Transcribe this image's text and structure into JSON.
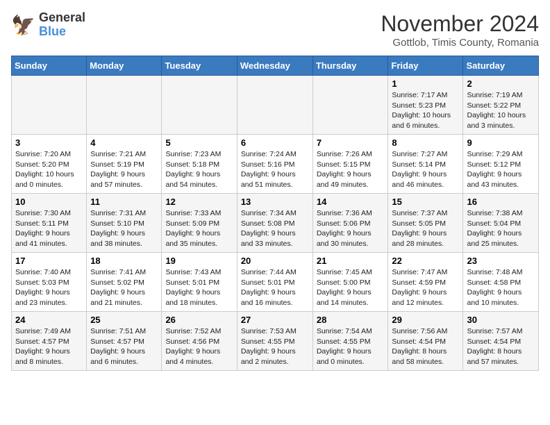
{
  "header": {
    "logo_general": "General",
    "logo_blue": "Blue",
    "month_title": "November 2024",
    "location": "Gottlob, Timis County, Romania"
  },
  "days_of_week": [
    "Sunday",
    "Monday",
    "Tuesday",
    "Wednesday",
    "Thursday",
    "Friday",
    "Saturday"
  ],
  "weeks": [
    [
      {
        "day": "",
        "info": ""
      },
      {
        "day": "",
        "info": ""
      },
      {
        "day": "",
        "info": ""
      },
      {
        "day": "",
        "info": ""
      },
      {
        "day": "",
        "info": ""
      },
      {
        "day": "1",
        "info": "Sunrise: 7:17 AM\nSunset: 5:23 PM\nDaylight: 10 hours and 6 minutes."
      },
      {
        "day": "2",
        "info": "Sunrise: 7:19 AM\nSunset: 5:22 PM\nDaylight: 10 hours and 3 minutes."
      }
    ],
    [
      {
        "day": "3",
        "info": "Sunrise: 7:20 AM\nSunset: 5:20 PM\nDaylight: 10 hours and 0 minutes."
      },
      {
        "day": "4",
        "info": "Sunrise: 7:21 AM\nSunset: 5:19 PM\nDaylight: 9 hours and 57 minutes."
      },
      {
        "day": "5",
        "info": "Sunrise: 7:23 AM\nSunset: 5:18 PM\nDaylight: 9 hours and 54 minutes."
      },
      {
        "day": "6",
        "info": "Sunrise: 7:24 AM\nSunset: 5:16 PM\nDaylight: 9 hours and 51 minutes."
      },
      {
        "day": "7",
        "info": "Sunrise: 7:26 AM\nSunset: 5:15 PM\nDaylight: 9 hours and 49 minutes."
      },
      {
        "day": "8",
        "info": "Sunrise: 7:27 AM\nSunset: 5:14 PM\nDaylight: 9 hours and 46 minutes."
      },
      {
        "day": "9",
        "info": "Sunrise: 7:29 AM\nSunset: 5:12 PM\nDaylight: 9 hours and 43 minutes."
      }
    ],
    [
      {
        "day": "10",
        "info": "Sunrise: 7:30 AM\nSunset: 5:11 PM\nDaylight: 9 hours and 41 minutes."
      },
      {
        "day": "11",
        "info": "Sunrise: 7:31 AM\nSunset: 5:10 PM\nDaylight: 9 hours and 38 minutes."
      },
      {
        "day": "12",
        "info": "Sunrise: 7:33 AM\nSunset: 5:09 PM\nDaylight: 9 hours and 35 minutes."
      },
      {
        "day": "13",
        "info": "Sunrise: 7:34 AM\nSunset: 5:08 PM\nDaylight: 9 hours and 33 minutes."
      },
      {
        "day": "14",
        "info": "Sunrise: 7:36 AM\nSunset: 5:06 PM\nDaylight: 9 hours and 30 minutes."
      },
      {
        "day": "15",
        "info": "Sunrise: 7:37 AM\nSunset: 5:05 PM\nDaylight: 9 hours and 28 minutes."
      },
      {
        "day": "16",
        "info": "Sunrise: 7:38 AM\nSunset: 5:04 PM\nDaylight: 9 hours and 25 minutes."
      }
    ],
    [
      {
        "day": "17",
        "info": "Sunrise: 7:40 AM\nSunset: 5:03 PM\nDaylight: 9 hours and 23 minutes."
      },
      {
        "day": "18",
        "info": "Sunrise: 7:41 AM\nSunset: 5:02 PM\nDaylight: 9 hours and 21 minutes."
      },
      {
        "day": "19",
        "info": "Sunrise: 7:43 AM\nSunset: 5:01 PM\nDaylight: 9 hours and 18 minutes."
      },
      {
        "day": "20",
        "info": "Sunrise: 7:44 AM\nSunset: 5:01 PM\nDaylight: 9 hours and 16 minutes."
      },
      {
        "day": "21",
        "info": "Sunrise: 7:45 AM\nSunset: 5:00 PM\nDaylight: 9 hours and 14 minutes."
      },
      {
        "day": "22",
        "info": "Sunrise: 7:47 AM\nSunset: 4:59 PM\nDaylight: 9 hours and 12 minutes."
      },
      {
        "day": "23",
        "info": "Sunrise: 7:48 AM\nSunset: 4:58 PM\nDaylight: 9 hours and 10 minutes."
      }
    ],
    [
      {
        "day": "24",
        "info": "Sunrise: 7:49 AM\nSunset: 4:57 PM\nDaylight: 9 hours and 8 minutes."
      },
      {
        "day": "25",
        "info": "Sunrise: 7:51 AM\nSunset: 4:57 PM\nDaylight: 9 hours and 6 minutes."
      },
      {
        "day": "26",
        "info": "Sunrise: 7:52 AM\nSunset: 4:56 PM\nDaylight: 9 hours and 4 minutes."
      },
      {
        "day": "27",
        "info": "Sunrise: 7:53 AM\nSunset: 4:55 PM\nDaylight: 9 hours and 2 minutes."
      },
      {
        "day": "28",
        "info": "Sunrise: 7:54 AM\nSunset: 4:55 PM\nDaylight: 9 hours and 0 minutes."
      },
      {
        "day": "29",
        "info": "Sunrise: 7:56 AM\nSunset: 4:54 PM\nDaylight: 8 hours and 58 minutes."
      },
      {
        "day": "30",
        "info": "Sunrise: 7:57 AM\nSunset: 4:54 PM\nDaylight: 8 hours and 57 minutes."
      }
    ]
  ]
}
